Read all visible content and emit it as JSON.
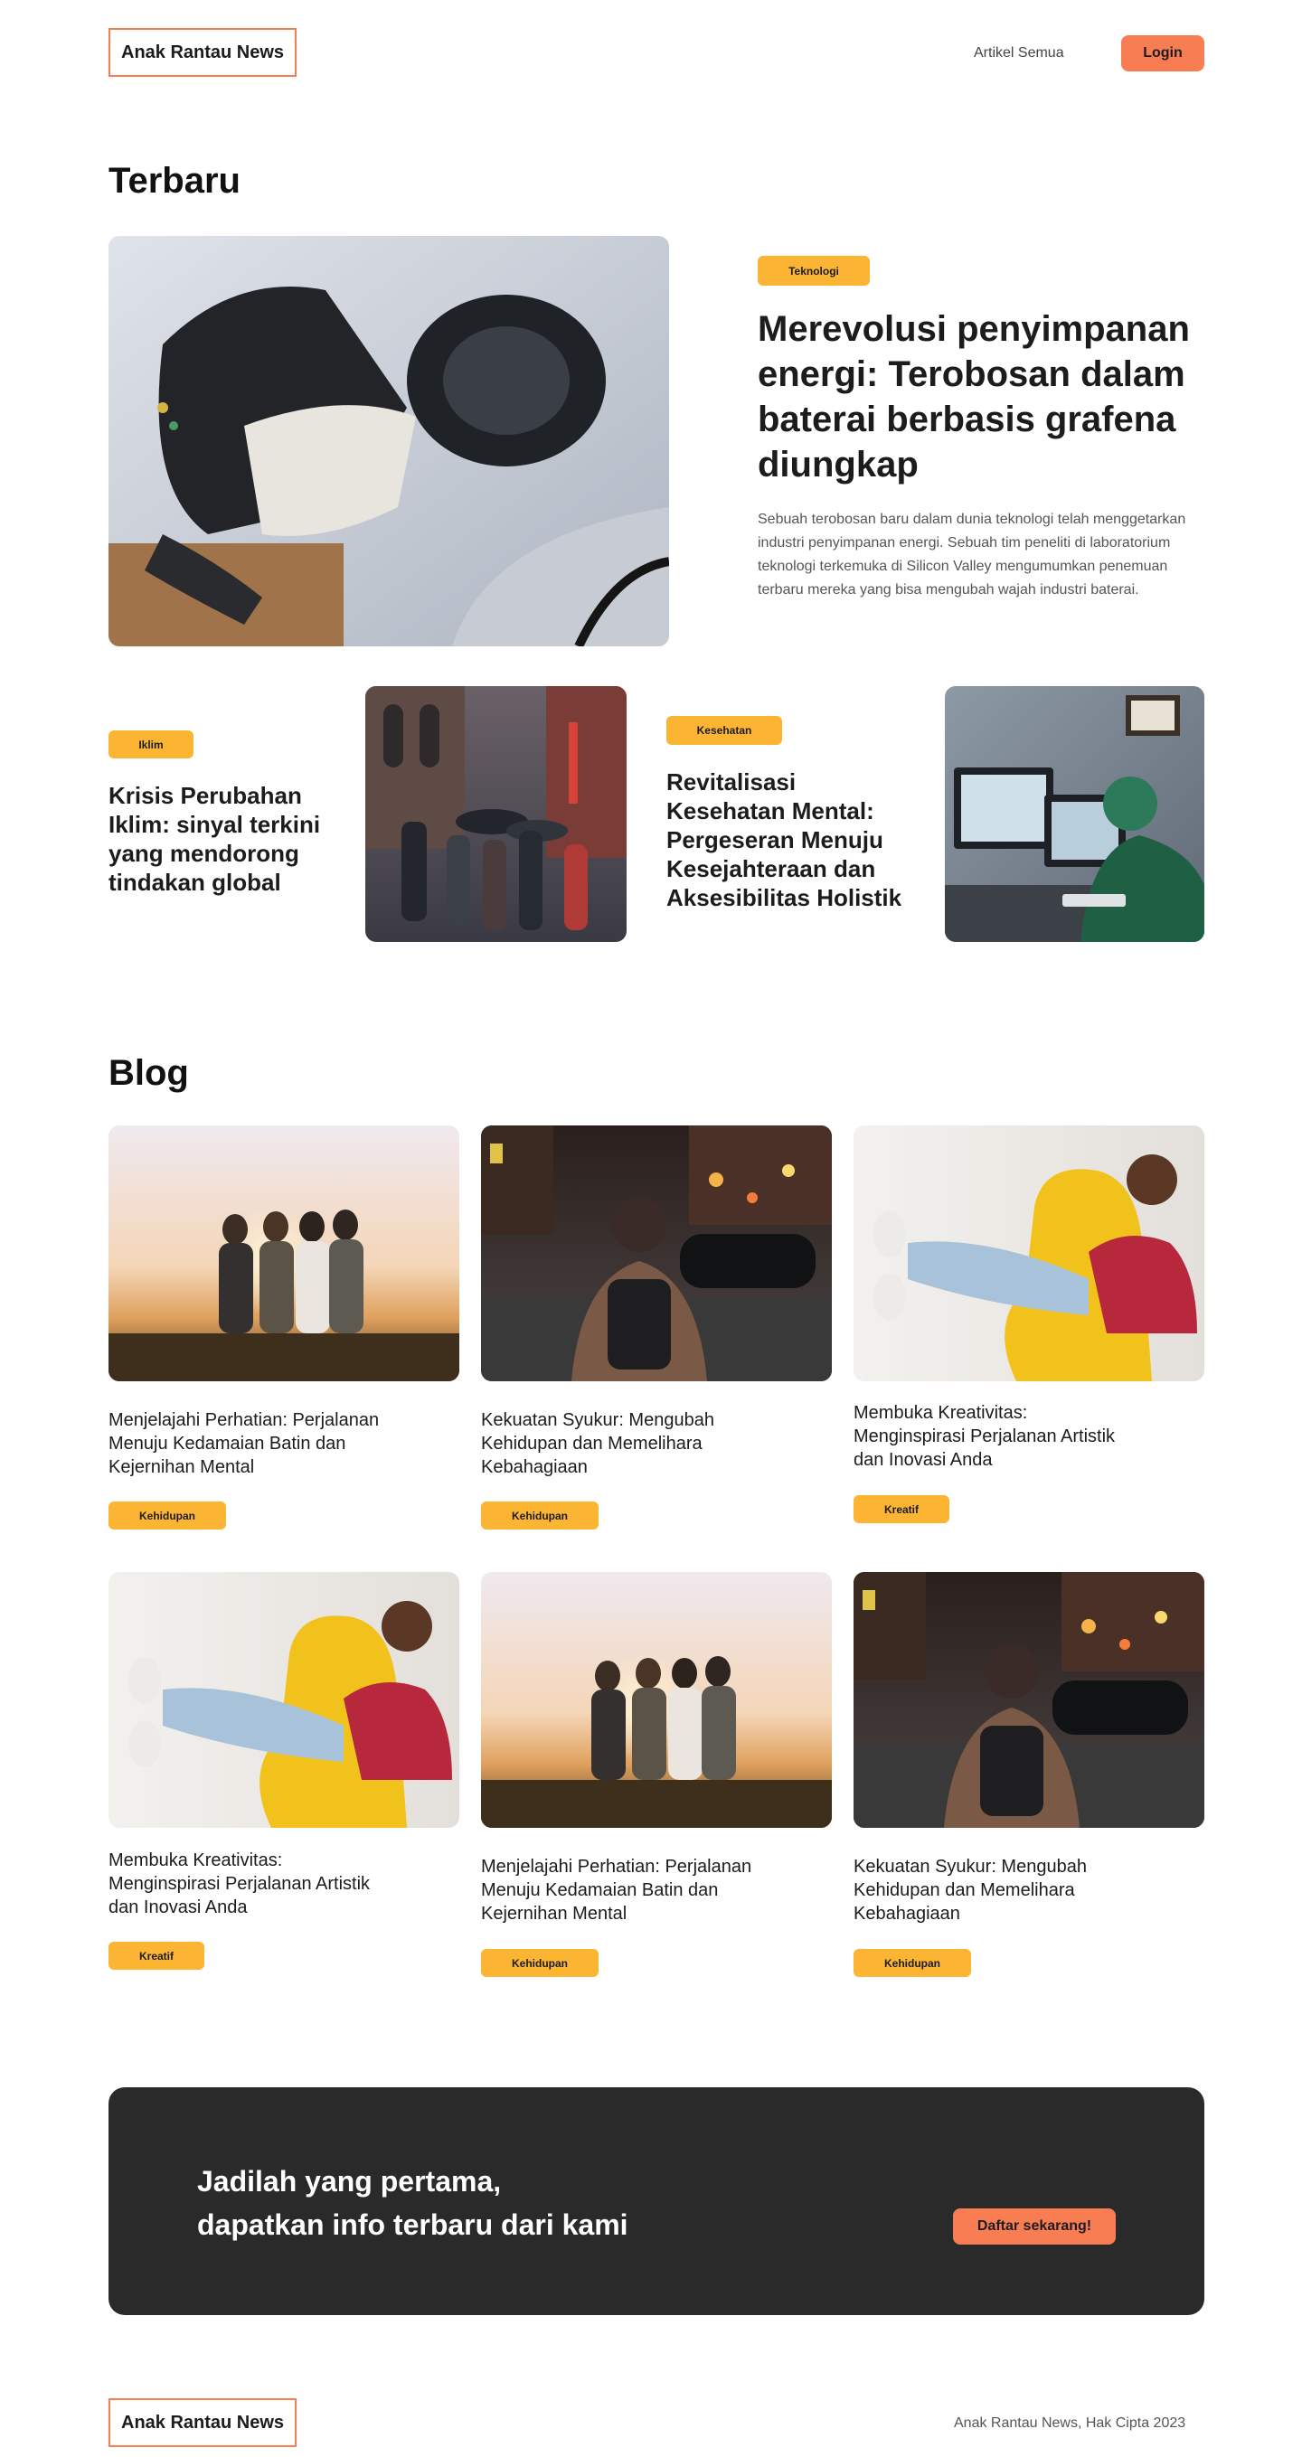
{
  "header": {
    "logo": "Anak Rantau News",
    "nav_all_articles": "Artikel Semua",
    "login_label": "Login"
  },
  "latest": {
    "section_title": "Terbaru",
    "hero": {
      "badge": "Teknologi",
      "title": "Merevolusi penyimpanan energi: Terobosan dalam baterai berbasis grafena diungkap",
      "excerpt": "Sebuah terobosan baru dalam dunia teknologi telah menggetarkan industri penyimpanan energi. Sebuah tim peneliti di laboratorium teknologi terkemuka di Silicon Valley mengumumkan penemuan terbaru mereka yang bisa mengubah wajah industri baterai.",
      "image_alt": "electric-car-charging-photo"
    },
    "secondary": [
      {
        "badge": "Iklim",
        "title": "Krisis Perubahan Iklim: sinyal terkini yang mendorong tindakan global",
        "image_alt": "rainy-street-crowd-photo"
      },
      {
        "badge": "Kesehatan",
        "title": "Revitalisasi Kesehatan Mental: Pergeseran Menuju Kesejahteraan dan Aksesibilitas Holistik",
        "image_alt": "lab-worker-computer-photo"
      }
    ]
  },
  "blog": {
    "section_title": "Blog",
    "posts": [
      {
        "title": "Menjelajahi Perhatian: Perjalanan Menuju Kedamaian Batin dan Kejernihan Mental",
        "badge": "Kehidupan",
        "image": "friends-sunset"
      },
      {
        "title": "Kekuatan Syukur: Mengubah Kehidupan dan Memelihara Kebahagiaan",
        "badge": "Kehidupan",
        "image": "city-night-backpack"
      },
      {
        "title": "Membuka Kreativitas: Menginspirasi Perjalanan Artistik dan Inovasi Anda",
        "badge": "Kreatif",
        "image": "yellow-chair-woman"
      },
      {
        "title": "Membuka Kreativitas: Menginspirasi Perjalanan Artistik dan Inovasi Anda",
        "badge": "Kreatif",
        "image": "yellow-chair-woman"
      },
      {
        "title": "Menjelajahi Perhatian: Perjalanan Menuju Kedamaian Batin dan Kejernihan Mental",
        "badge": "Kehidupan",
        "image": "friends-sunset"
      },
      {
        "title": "Kekuatan Syukur: Mengubah Kehidupan dan Memelihara Kebahagiaan",
        "badge": "Kehidupan",
        "image": "city-night-backpack"
      }
    ]
  },
  "cta": {
    "line1": "Jadilah yang pertama,",
    "line2": "dapatkan info terbaru dari kami",
    "button": "Daftar sekarang!"
  },
  "footer": {
    "logo": "Anak Rantau News",
    "copyright": "Anak Rantau News, Hak Cipta 2023"
  },
  "colors": {
    "accent_orange": "#f97d52",
    "badge_yellow": "#fbb533",
    "cta_dark": "#2a2a2a"
  }
}
